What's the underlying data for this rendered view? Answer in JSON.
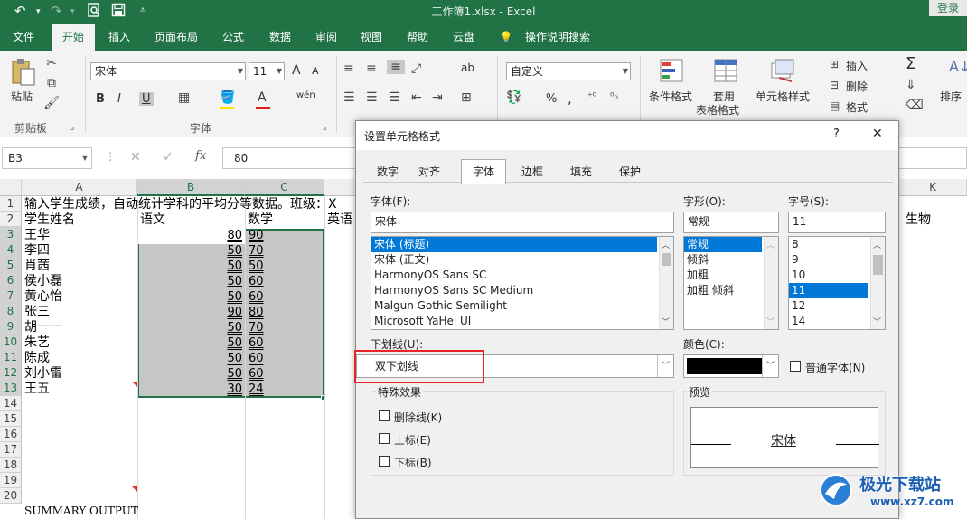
{
  "titlebar": {
    "title": "工作簿1.xlsx  -  Excel",
    "login": "登录"
  },
  "tabs": [
    "文件",
    "开始",
    "插入",
    "页面布局",
    "公式",
    "数据",
    "审阅",
    "视图",
    "帮助",
    "云盘",
    "操作说明搜索"
  ],
  "ribbon": {
    "paste": "粘贴",
    "clipboard_group": "剪贴板",
    "font_name": "宋体",
    "font_size": "11",
    "font_group": "字体",
    "number_format": "自定义",
    "conditional_format": "条件格式",
    "table_format_1": "套用",
    "table_format_2": "表格格式",
    "cell_style": "单元格样式",
    "insert": "插入",
    "delete": "删除",
    "format": "格式",
    "sort": "排序",
    "bold": "B",
    "italic": "I",
    "underline": "U",
    "wen": "wén",
    "font_grow": "A",
    "font_shrink": "A",
    "font_color": "A",
    "percent": "%",
    "comma": ",",
    "abc": "ab",
    "sigma": "Σ"
  },
  "formula_bar": {
    "name_box": "B3",
    "fx": "fx",
    "value": "80",
    "cancel": "✕",
    "confirm": "✓"
  },
  "columns": [
    "A",
    "B",
    "C",
    "K"
  ],
  "rows": [
    "1",
    "2",
    "3",
    "4",
    "5",
    "6",
    "7",
    "8",
    "9",
    "10",
    "11",
    "12",
    "13",
    "14",
    "15",
    "16",
    "17",
    "18",
    "19",
    "20"
  ],
  "sheet": {
    "r1": "输入学生成绩，自动统计学科的平均分等数据。班级：X",
    "headers": [
      "学生姓名",
      "语文",
      "数学",
      "英语"
    ],
    "k_header": "生物",
    "students": [
      {
        "name": "王华",
        "chinese": "80",
        "math": "90"
      },
      {
        "name": "李四",
        "chinese": "50",
        "math": "70"
      },
      {
        "name": "肖茜",
        "chinese": "50",
        "math": "50"
      },
      {
        "name": "侯小磊",
        "chinese": "50",
        "math": "60"
      },
      {
        "name": "黄心怡",
        "chinese": "50",
        "math": "60"
      },
      {
        "name": "张三",
        "chinese": "90",
        "math": "80"
      },
      {
        "name": "胡一一",
        "chinese": "50",
        "math": "70"
      },
      {
        "name": "朱艺",
        "chinese": "50",
        "math": "60"
      },
      {
        "name": "陈成",
        "chinese": "50",
        "math": "60"
      },
      {
        "name": "刘小雷",
        "chinese": "50",
        "math": "60"
      },
      {
        "name": "王五",
        "chinese": "30",
        "math": "24"
      }
    ],
    "r20": "SUMMARY OUTPUT"
  },
  "dialog": {
    "title": "设置单元格格式",
    "help": "?",
    "close": "✕",
    "tabs": [
      "数字",
      "对齐",
      "字体",
      "边框",
      "填充",
      "保护"
    ],
    "active_tab": "字体",
    "font_label": "字体(F):",
    "font_value": "宋体",
    "fonts": [
      "宋体 (标题)",
      "宋体 (正文)",
      "HarmonyOS Sans SC",
      "HarmonyOS Sans SC Medium",
      "Malgun Gothic Semilight",
      "Microsoft YaHei UI"
    ],
    "style_label": "字形(O):",
    "style_value": "常规",
    "styles": [
      "常规",
      "倾斜",
      "加粗",
      "加粗 倾斜"
    ],
    "size_label": "字号(S):",
    "size_value": "11",
    "sizes": [
      "8",
      "9",
      "10",
      "11",
      "12",
      "14"
    ],
    "underline_label": "下划线(U):",
    "underline_value": "双下划线",
    "color_label": "颜色(C):",
    "color_value": "#000000",
    "normal_font": "普通字体(N)",
    "effects_label": "特殊效果",
    "strike": "删除线(K)",
    "superscript": "上标(E)",
    "subscript": "下标(B)",
    "preview_label": "预览",
    "preview_text": "宋体"
  },
  "watermark": {
    "name": "极光下载站",
    "url": "www.xz7.com"
  }
}
